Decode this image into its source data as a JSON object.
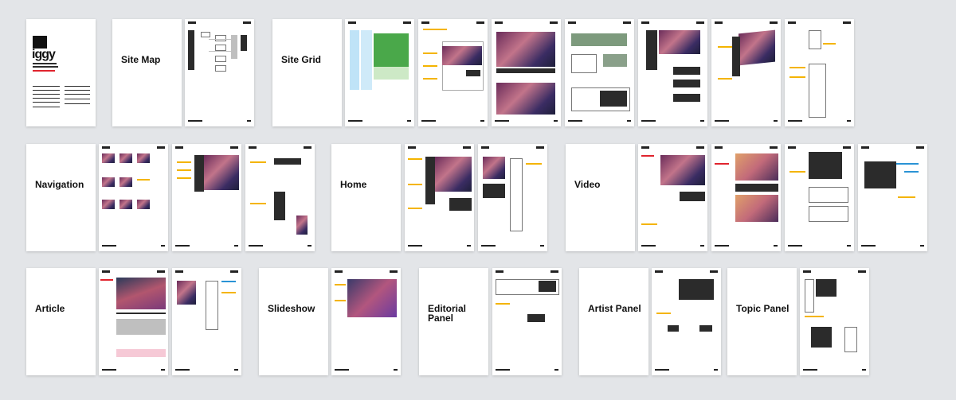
{
  "sections": {
    "site_map": "Site Map",
    "site_grid": "Site Grid",
    "navigation": "Navigation",
    "home": "Home",
    "video": "Video",
    "article": "Article",
    "slideshow": "Slideshow",
    "editorial_panel": "Editorial\nPanel",
    "artist_panel": "Artist Panel",
    "topic_panel": "Topic Panel"
  },
  "cover": {
    "logo": "iggy"
  },
  "colors": {
    "background": "#e3e5e8",
    "annotation": "#f4b400",
    "accent_red": "#e0242e",
    "accent_blue": "#2a93d5",
    "purple": "#5b2d8a",
    "green": "#3f9b3f"
  }
}
